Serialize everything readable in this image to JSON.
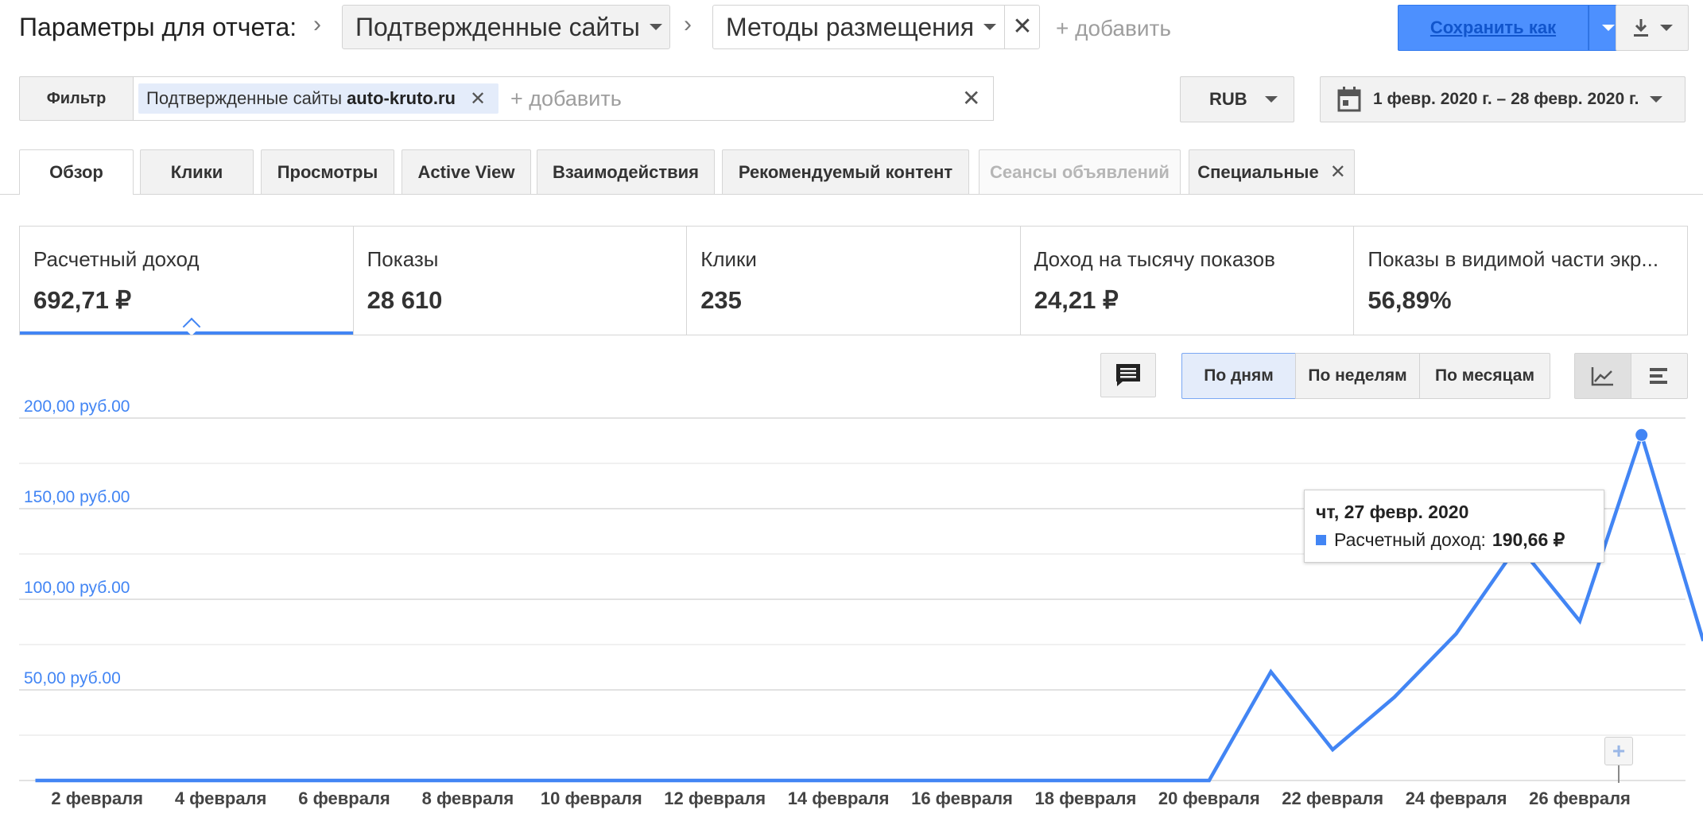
{
  "header": {
    "params_label": "Параметры для отчета:",
    "dimension1": "Подтвержденные сайты",
    "dimension2": "Методы размещения",
    "add_label": "+ добавить",
    "save_label": "Сохранить как"
  },
  "filter": {
    "button_label": "Фильтр",
    "chip_label": "Подтвержденные сайты",
    "chip_value": "auto-kruto.ru",
    "add_label": "+ добавить",
    "currency": "RUB",
    "date_range": "1 февр. 2020 г. – 28 февр. 2020 г."
  },
  "tabs": [
    {
      "label": "Обзор",
      "state": "active"
    },
    {
      "label": "Клики",
      "state": "normal"
    },
    {
      "label": "Просмотры",
      "state": "normal"
    },
    {
      "label": "Active View",
      "state": "normal"
    },
    {
      "label": "Взаимодействия",
      "state": "normal"
    },
    {
      "label": "Рекомендуемый контент",
      "state": "normal"
    },
    {
      "label": "Сеансы объявлений",
      "state": "disabled"
    },
    {
      "label": "Специальные",
      "state": "normal",
      "closable": true
    }
  ],
  "scorecards": [
    {
      "title": "Расчетный доход",
      "value": "692,71 ₽",
      "selected": true
    },
    {
      "title": "Показы",
      "value": "28 610"
    },
    {
      "title": "Клики",
      "value": "235"
    },
    {
      "title": "Доход на тысячу показов",
      "value": "24,21 ₽"
    },
    {
      "title": "Показы в видимой части экр...",
      "value": "56,89%"
    }
  ],
  "granularity": {
    "options": [
      "По дням",
      "По неделям",
      "По месяцам"
    ],
    "selected": "По дням"
  },
  "colors": {
    "accent": "#4285f4",
    "primary_button": "#4d90fe",
    "link": "#1155cc",
    "axis_label": "#4285f4"
  },
  "tooltip": {
    "date": "чт, 27 февр. 2020",
    "series_label": "Расчетный доход:",
    "value": "190,66 ₽"
  },
  "chart_data": {
    "type": "line",
    "y_tick_labels": [
      "200,00 руб.00",
      "150,00 руб.00",
      "100,00 руб.00",
      "50,00 руб.00"
    ],
    "y_ticks": [
      200,
      150,
      100,
      50
    ],
    "ylim": [
      0,
      200
    ],
    "x_tick_labels": [
      "2 февраля",
      "4 февраля",
      "6 февраля",
      "8 февраля",
      "10 февраля",
      "12 февраля",
      "14 февраля",
      "16 февраля",
      "18 февраля",
      "20 февраля",
      "22 февраля",
      "24 февраля",
      "26 февраля"
    ],
    "x_tick_days": [
      2,
      4,
      6,
      8,
      10,
      12,
      14,
      16,
      18,
      20,
      22,
      24,
      26
    ],
    "series": [
      {
        "name": "Расчетный доход",
        "x": [
          1,
          2,
          3,
          4,
          5,
          6,
          7,
          8,
          9,
          10,
          11,
          12,
          13,
          14,
          15,
          16,
          17,
          18,
          19,
          20,
          21,
          22,
          23,
          24,
          25,
          26,
          27,
          28
        ],
        "values": [
          0,
          0,
          0,
          0,
          0,
          0,
          0,
          0,
          0,
          0,
          0,
          0,
          0,
          0,
          0,
          0,
          0,
          0,
          0,
          0,
          60,
          17,
          46,
          81,
          130,
          88,
          190.66,
          77
        ]
      }
    ],
    "highlight_x": 27,
    "grid": true
  }
}
